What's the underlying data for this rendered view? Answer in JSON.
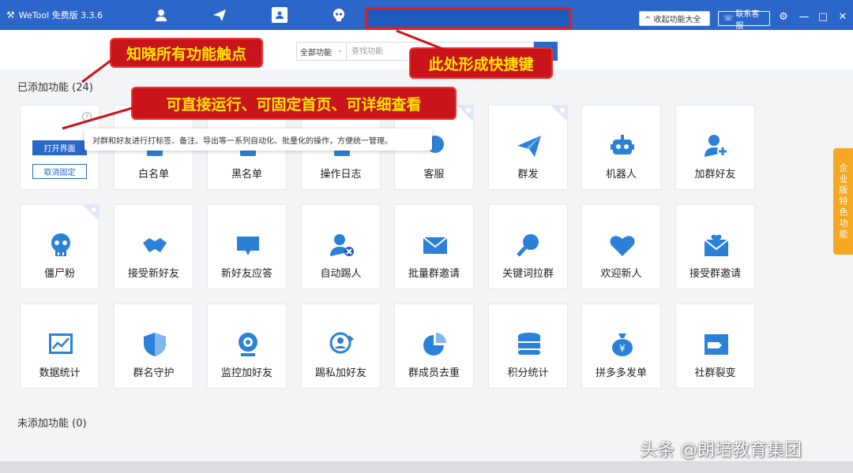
{
  "app": {
    "title": "WeTool 免费版 3.3.6"
  },
  "titlebar": {
    "nav_tabs": [
      "user-icon",
      "send-icon",
      "contact-card-icon",
      "skull-icon"
    ],
    "collapse_label": "^ 收起功能大全",
    "service_label": "联系客服"
  },
  "search": {
    "scope": "全部功能",
    "placeholder": "查找功能"
  },
  "annotations": {
    "touchpoints": "知晓所有功能触点",
    "shortcut": "此处形成快捷键",
    "actions": "可直接运行、可固定首页、可详细查看"
  },
  "added_section": {
    "title": "已添加功能 (24)"
  },
  "unadded_section": {
    "title": "未添加功能 (0)"
  },
  "card_actions": {
    "open": "打开界面",
    "unpin": "取消固定",
    "help": "?",
    "tooltip": "对群和好友进行打标签、备注、导出等一系列自动化、批量化的操作，方便统一管理。"
  },
  "features": [
    {
      "label": "",
      "icon": "tag-icon",
      "pinned": false
    },
    {
      "label": "白名单",
      "icon": "whitelist-icon",
      "pinned": false
    },
    {
      "label": "黑名单",
      "icon": "blacklist-icon",
      "pinned": false
    },
    {
      "label": "操作日志",
      "icon": "log-icon",
      "pinned": false
    },
    {
      "label": "客服",
      "icon": "headset-icon",
      "pinned": true
    },
    {
      "label": "群发",
      "icon": "send-icon",
      "pinned": true
    },
    {
      "label": "机器人",
      "icon": "robot-icon",
      "pinned": false
    },
    {
      "label": "加群好友",
      "icon": "add-friend-icon",
      "pinned": false
    },
    {
      "label": "僵尸粉",
      "icon": "skull-icon",
      "pinned": true
    },
    {
      "label": "接受新好友",
      "icon": "handshake-icon",
      "pinned": false
    },
    {
      "label": "新好友应答",
      "icon": "chat-bubble-icon",
      "pinned": false
    },
    {
      "label": "自动踢人",
      "icon": "remove-user-icon",
      "pinned": false
    },
    {
      "label": "批量群邀请",
      "icon": "envelope-icon",
      "pinned": false
    },
    {
      "label": "关键词拉群",
      "icon": "magnifier-icon",
      "pinned": false
    },
    {
      "label": "欢迎新人",
      "icon": "heart-icon",
      "pinned": false
    },
    {
      "label": "接受群邀请",
      "icon": "heart-envelope-icon",
      "pinned": false
    },
    {
      "label": "数据统计",
      "icon": "line-chart-icon",
      "pinned": false
    },
    {
      "label": "群名守护",
      "icon": "shield-icon",
      "pinned": false
    },
    {
      "label": "监控加好友",
      "icon": "webcam-icon",
      "pinned": false
    },
    {
      "label": "踢私加好友",
      "icon": "kick-user-icon",
      "pinned": false
    },
    {
      "label": "群成员去重",
      "icon": "pie-chart-icon",
      "pinned": false
    },
    {
      "label": "积分统计",
      "icon": "database-icon",
      "pinned": false
    },
    {
      "label": "拼多多发单",
      "icon": "money-bag-icon",
      "pinned": false
    },
    {
      "label": "社群裂变",
      "icon": "split-icon",
      "pinned": false
    }
  ],
  "side_tab": "企业版特色功能",
  "watermark": "头条 @朗培教育集团",
  "colors": {
    "primary": "#2b67c9",
    "callout_bg": "#c8141a",
    "callout_text": "#ffe400",
    "side_tab": "#f5a623"
  }
}
